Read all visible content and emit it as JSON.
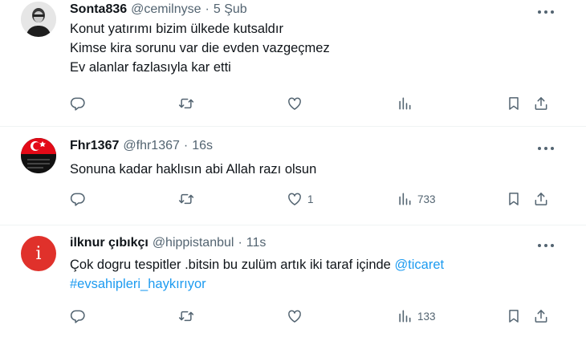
{
  "tweets": [
    {
      "name": "Sonta836",
      "handle": "@cemilnyse",
      "separator": "·",
      "time": "5 Şub",
      "lines": [
        "Konut yatırımı bizim ülkede kutsaldır",
        "Kimse kira sorunu var die evden vazgeçmez",
        "Ev alanlar fazlasıyla kar etti"
      ],
      "likes": "",
      "views": ""
    },
    {
      "name": "Fhr1367",
      "handle": "@fhr1367",
      "separator": "·",
      "time": "16s",
      "lines": [
        "Sonuna kadar haklısın abi Allah razı olsun"
      ],
      "likes": "1",
      "views": "733"
    },
    {
      "name": "ilknur çıbıkçı",
      "handle": "@hippistanbul",
      "separator": "·",
      "time": "11s",
      "text_part": "Çok dogru tespitler .bitsin bu zulüm artık iki taraf içinde ",
      "mention": "@ticaret",
      "hashtag": "#evsahipleri_haykırıyor",
      "avatar_letter": "i",
      "likes": "",
      "views": "133"
    }
  ],
  "colors": {
    "text": "#0f1419",
    "muted": "#536471",
    "link": "#1d9bf0",
    "divider": "#eff3f4",
    "avatar3": "#e0312b"
  },
  "icons": [
    "reply-icon",
    "retweet-icon",
    "like-icon",
    "views-icon",
    "bookmark-icon",
    "share-icon",
    "more-icon"
  ]
}
